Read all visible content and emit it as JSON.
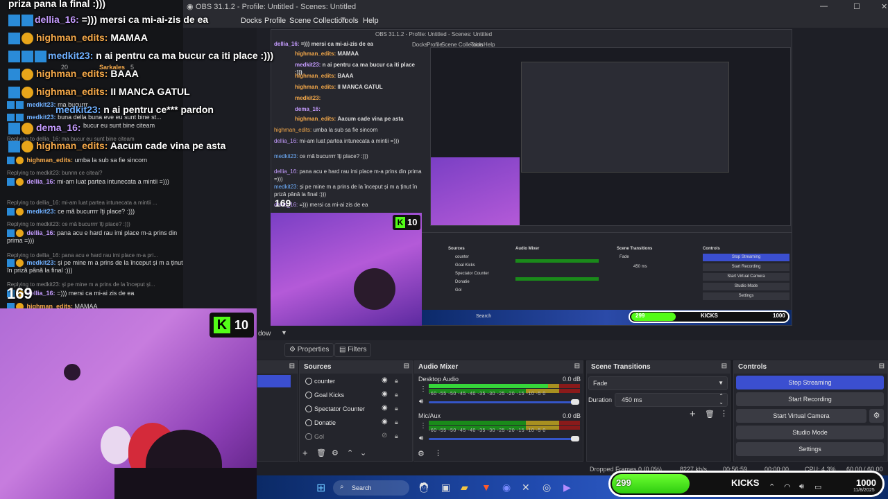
{
  "obs": {
    "title": "OBS 31.1.2 - Profile: Untitled - Scenes: Untitled",
    "menu": [
      "Docks",
      "Profile",
      "Scene Collection",
      "Tools",
      "Help"
    ],
    "nested_title": "OBS 31.1.2 - Profile: Untitled - Scenes: Untitled",
    "nested_menu": [
      "Docks",
      "Profile",
      "Scene Collection",
      "Tools",
      "Help"
    ]
  },
  "overlay_chat": [
    {
      "user": "",
      "text": "priza pana la final :)))"
    },
    {
      "user": "dellia_16:",
      "text": "=))) mersi ca mi-ai-zis de ea"
    },
    {
      "user": "highman_edits:",
      "text": "MAMAA"
    },
    {
      "user": "medkit23:",
      "text": "n ai pentru ca ma bucur ca iti place :)))"
    },
    {
      "user": "highman_edits:",
      "text": "BAAA"
    },
    {
      "user": "highman_edits:",
      "text": "II MANCA GATUL"
    },
    {
      "user": "medkit23:",
      "text": "n ai pentru ce*** pardon"
    },
    {
      "user": "dema_16:",
      "text": ""
    },
    {
      "user": "highman_edits:",
      "text": "Aacum cade vina pe asta"
    }
  ],
  "chat_panel": {
    "lines": [
      {
        "type": "msg",
        "user": "medkit23:",
        "color": "#6fb0ff",
        "text": "ma bucurrr"
      },
      {
        "type": "msg",
        "user": "medkit23:",
        "color": "#6fb0ff",
        "text": "buna della buna eve eu sunt bine st..."
      },
      {
        "type": "msg",
        "user": "",
        "color": "#ffffff",
        "text": "bucur eu sunt bine citeam"
      },
      {
        "type": "reply",
        "text": "Replying to dellia_16: ma bucur eu sunt bine citeam"
      },
      {
        "type": "msg",
        "user": "highman_edits:",
        "color": "#f5a94a",
        "text": "umba la sub sa fie sincorn"
      },
      {
        "type": "reply",
        "text": "Replying to medkit23: bunnn ce citeai?"
      },
      {
        "type": "msg",
        "user": "dellia_16:",
        "color": "#c59cff",
        "text": "mi-am luat partea intunecata a mintii =)))"
      },
      {
        "type": "reply",
        "text": "Replying to dellia_16: mi-am luat partea intunecata a mintii ..."
      },
      {
        "type": "msg",
        "user": "medkit23:",
        "color": "#6fb0ff",
        "text": "ce mã bucurrrr îţi place? :)))"
      },
      {
        "type": "reply",
        "text": "Replying to medkit23: ce mă bucurrrr îţi place? :)))"
      },
      {
        "type": "msg",
        "user": "dellia_16:",
        "color": "#c59cff",
        "text": "pana acu e hard rau imi place m-a prins din prima =)))"
      },
      {
        "type": "reply",
        "text": "Replying to dellia_16: pana acu e hard rau imi place m-a pri..."
      },
      {
        "type": "msg",
        "user": "medkit23:",
        "color": "#6fb0ff",
        "text": "și pe mine m a prins de la început și m a ținut în priză până la final :)))"
      },
      {
        "type": "reply",
        "text": "Replying to medkit23: și pe mine m a prins de la început și..."
      },
      {
        "type": "msg",
        "user": "dellia_16:",
        "color": "#c59cff",
        "text": "=))) mersi ca mi-ai zis de ea"
      },
      {
        "type": "msg",
        "user": "highman_edits:",
        "color": "#f5a94a",
        "text": "MAMAA"
      }
    ],
    "sarkales": "Sarkales",
    "sarkales_n": "5",
    "count_20": "20",
    "viewers": "169"
  },
  "kick_badge": {
    "value": "10"
  },
  "nested_badge": {
    "value": "10"
  },
  "docks": {
    "properties_label": "Properties",
    "filters_label": "Filters",
    "toolbar_label": "dow",
    "sources": {
      "title": "Sources",
      "items": [
        "counter",
        "Goal Kicks",
        "Spectator Counter",
        "Donatie",
        "Gol"
      ]
    },
    "audio": {
      "title": "Audio Mixer",
      "desktop": {
        "name": "Desktop Audio",
        "db": "0.0 dB",
        "level": 0.79
      },
      "mic": {
        "name": "Mic/Aux",
        "db": "0.0 dB",
        "level": 0.0
      },
      "scale": "-60  -55  -50  -45  -40  -35  -30  -25  -20  -15  -10  -5  0"
    },
    "transitions": {
      "title": "Scene Transitions",
      "selected": "Fade",
      "duration_label": "Duration",
      "duration_value": "450 ms"
    },
    "controls": {
      "title": "Controls",
      "buttons": [
        "Stop Streaming",
        "Start Recording",
        "Start Virtual Camera",
        "Studio Mode",
        "Settings"
      ]
    }
  },
  "statusbar": {
    "dropped": "Dropped Frames 0 (0.0%)",
    "kbps": "8227 kb/s",
    "time": "00:56:59",
    "time2": "00:00:00",
    "cpu": "CPU: 4.3%",
    "fps": "60.00 / 60.00 FPS"
  },
  "taskbar": {
    "search": "Search",
    "date": "11/8/2025"
  },
  "kicks_bar": {
    "current": "299",
    "label": "KICKS",
    "goal": "1000",
    "progress": 0.299
  },
  "nested_kicks": {
    "current": "299",
    "label": "KICKS",
    "goal": "1000"
  },
  "nested_controls": [
    "Stop Streaming",
    "Start Recording",
    "Start Virtual Camera",
    "Studio Mode",
    "Settings"
  ],
  "nested_sources": [
    "counter",
    "Goal Kicks",
    "Spectator Counter",
    "Donatie",
    "Gol"
  ],
  "nested_transition": "Fade",
  "nested_duration": "450 ms",
  "colors": {
    "accent": "#3b4fd0",
    "kick_green": "#53fc18"
  }
}
